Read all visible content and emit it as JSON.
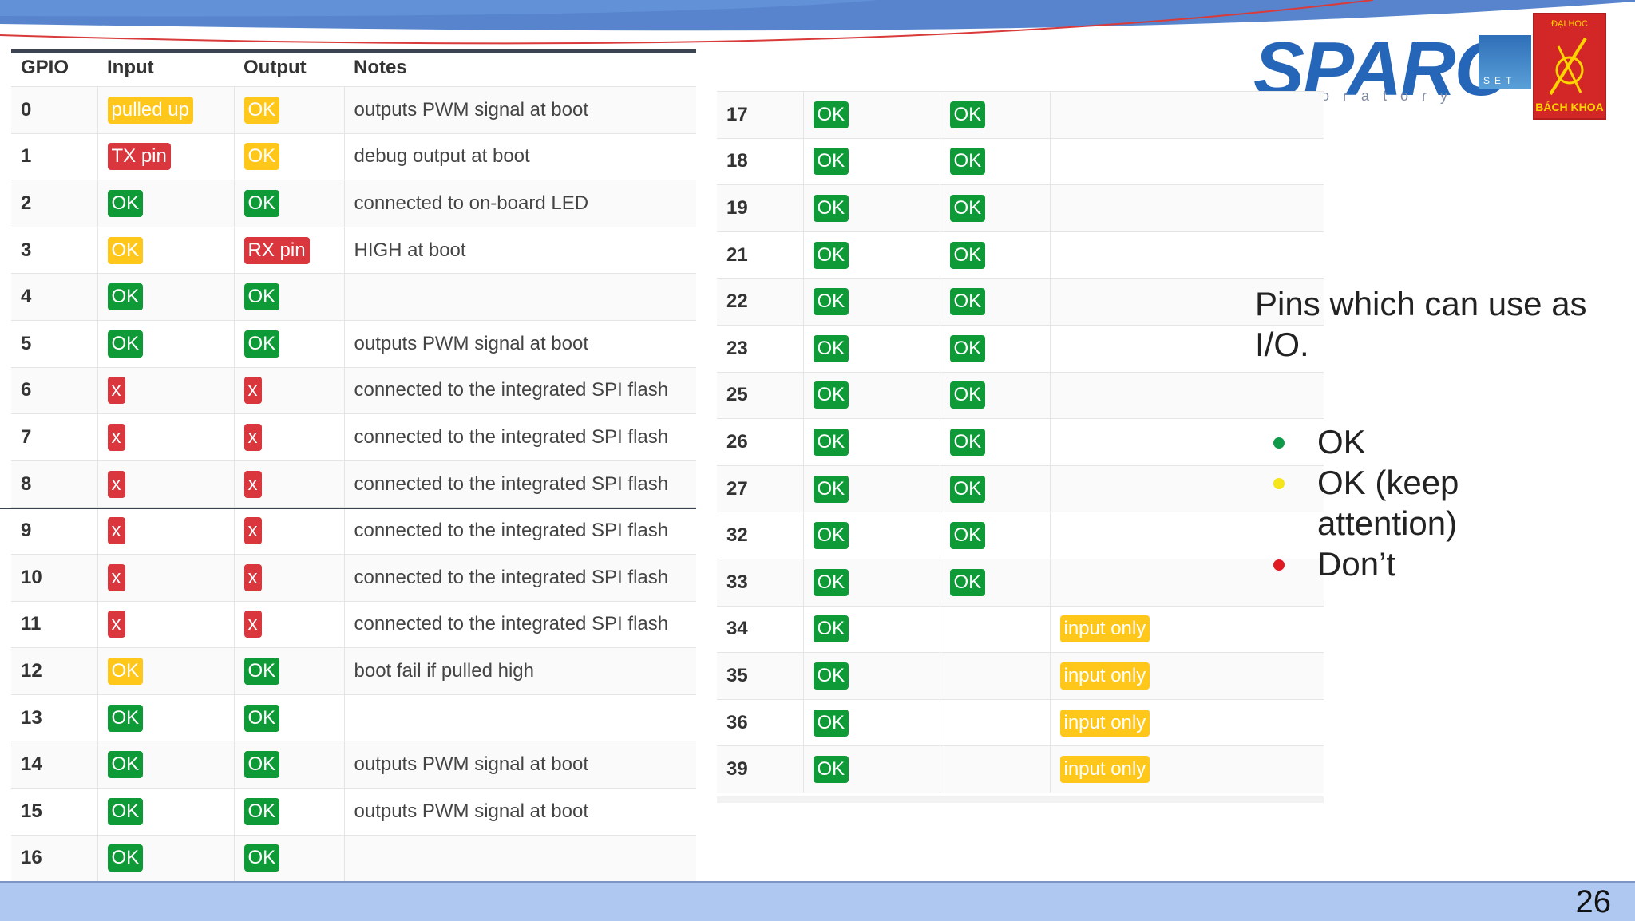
{
  "left_table": {
    "headers": [
      "GPIO",
      "Input",
      "Output",
      "Notes"
    ],
    "rows": [
      {
        "gpio": "0",
        "input": {
          "text": "pulled up",
          "status": "warn"
        },
        "output": {
          "text": "OK",
          "status": "warn"
        },
        "notes": "outputs PWM signal at boot"
      },
      {
        "gpio": "1",
        "input": {
          "text": "TX pin",
          "status": "bad"
        },
        "output": {
          "text": "OK",
          "status": "warn"
        },
        "notes": "debug output at boot"
      },
      {
        "gpio": "2",
        "input": {
          "text": "OK",
          "status": "ok"
        },
        "output": {
          "text": "OK",
          "status": "ok"
        },
        "notes": "connected to on-board LED"
      },
      {
        "gpio": "3",
        "input": {
          "text": "OK",
          "status": "warn"
        },
        "output": {
          "text": "RX pin",
          "status": "bad"
        },
        "notes": "HIGH at boot"
      },
      {
        "gpio": "4",
        "input": {
          "text": "OK",
          "status": "ok"
        },
        "output": {
          "text": "OK",
          "status": "ok"
        },
        "notes": ""
      },
      {
        "gpio": "5",
        "input": {
          "text": "OK",
          "status": "ok"
        },
        "output": {
          "text": "OK",
          "status": "ok"
        },
        "notes": "outputs PWM signal at boot"
      },
      {
        "gpio": "6",
        "input": {
          "text": "x",
          "status": "bad"
        },
        "output": {
          "text": "x",
          "status": "bad"
        },
        "notes": "connected to the integrated SPI flash"
      },
      {
        "gpio": "7",
        "input": {
          "text": "x",
          "status": "bad"
        },
        "output": {
          "text": "x",
          "status": "bad"
        },
        "notes": "connected to the integrated SPI flash"
      },
      {
        "gpio": "8",
        "input": {
          "text": "x",
          "status": "bad"
        },
        "output": {
          "text": "x",
          "status": "bad"
        },
        "notes": "connected to the integrated SPI flash"
      },
      {
        "gpio": "9",
        "input": {
          "text": "x",
          "status": "bad"
        },
        "output": {
          "text": "x",
          "status": "bad"
        },
        "notes": "connected to the integrated SPI flash"
      },
      {
        "gpio": "10",
        "input": {
          "text": "x",
          "status": "bad"
        },
        "output": {
          "text": "x",
          "status": "bad"
        },
        "notes": "connected to the integrated SPI flash"
      },
      {
        "gpio": "11",
        "input": {
          "text": "x",
          "status": "bad"
        },
        "output": {
          "text": "x",
          "status": "bad"
        },
        "notes": "connected to the integrated SPI flash"
      },
      {
        "gpio": "12",
        "input": {
          "text": "OK",
          "status": "warn"
        },
        "output": {
          "text": "OK",
          "status": "ok"
        },
        "notes": "boot fail if pulled high"
      },
      {
        "gpio": "13",
        "input": {
          "text": "OK",
          "status": "ok"
        },
        "output": {
          "text": "OK",
          "status": "ok"
        },
        "notes": ""
      },
      {
        "gpio": "14",
        "input": {
          "text": "OK",
          "status": "ok"
        },
        "output": {
          "text": "OK",
          "status": "ok"
        },
        "notes": "outputs PWM signal at boot"
      },
      {
        "gpio": "15",
        "input": {
          "text": "OK",
          "status": "ok"
        },
        "output": {
          "text": "OK",
          "status": "ok"
        },
        "notes": "outputs PWM signal at boot"
      },
      {
        "gpio": "16",
        "input": {
          "text": "OK",
          "status": "ok"
        },
        "output": {
          "text": "OK",
          "status": "ok"
        },
        "notes": ""
      }
    ]
  },
  "right_table": {
    "rows": [
      {
        "gpio": "17",
        "input": {
          "text": "OK",
          "status": "ok"
        },
        "output": {
          "text": "OK",
          "status": "ok"
        },
        "notes": null
      },
      {
        "gpio": "18",
        "input": {
          "text": "OK",
          "status": "ok"
        },
        "output": {
          "text": "OK",
          "status": "ok"
        },
        "notes": null
      },
      {
        "gpio": "19",
        "input": {
          "text": "OK",
          "status": "ok"
        },
        "output": {
          "text": "OK",
          "status": "ok"
        },
        "notes": null
      },
      {
        "gpio": "21",
        "input": {
          "text": "OK",
          "status": "ok"
        },
        "output": {
          "text": "OK",
          "status": "ok"
        },
        "notes": null
      },
      {
        "gpio": "22",
        "input": {
          "text": "OK",
          "status": "ok"
        },
        "output": {
          "text": "OK",
          "status": "ok"
        },
        "notes": null
      },
      {
        "gpio": "23",
        "input": {
          "text": "OK",
          "status": "ok"
        },
        "output": {
          "text": "OK",
          "status": "ok"
        },
        "notes": null
      },
      {
        "gpio": "25",
        "input": {
          "text": "OK",
          "status": "ok"
        },
        "output": {
          "text": "OK",
          "status": "ok"
        },
        "notes": null
      },
      {
        "gpio": "26",
        "input": {
          "text": "OK",
          "status": "ok"
        },
        "output": {
          "text": "OK",
          "status": "ok"
        },
        "notes": null
      },
      {
        "gpio": "27",
        "input": {
          "text": "OK",
          "status": "ok"
        },
        "output": {
          "text": "OK",
          "status": "ok"
        },
        "notes": null
      },
      {
        "gpio": "32",
        "input": {
          "text": "OK",
          "status": "ok"
        },
        "output": {
          "text": "OK",
          "status": "ok"
        },
        "notes": null
      },
      {
        "gpio": "33",
        "input": {
          "text": "OK",
          "status": "ok"
        },
        "output": {
          "text": "OK",
          "status": "ok"
        },
        "notes": null
      },
      {
        "gpio": "34",
        "input": {
          "text": "OK",
          "status": "ok"
        },
        "output": null,
        "notes": {
          "text": "input only",
          "status": "warn"
        }
      },
      {
        "gpio": "35",
        "input": {
          "text": "OK",
          "status": "ok"
        },
        "output": null,
        "notes": {
          "text": "input only",
          "status": "warn"
        }
      },
      {
        "gpio": "36",
        "input": {
          "text": "OK",
          "status": "ok"
        },
        "output": null,
        "notes": {
          "text": "input only",
          "status": "warn"
        }
      },
      {
        "gpio": "39",
        "input": {
          "text": "OK",
          "status": "ok"
        },
        "output": null,
        "notes": {
          "text": "input only",
          "status": "warn"
        }
      }
    ]
  },
  "side_text": "Pins which can use as I/O.",
  "legend": [
    {
      "label": "OK",
      "color": "#0f9a4a"
    },
    {
      "label": "OK (keep attention)",
      "color": "#f5e51a"
    },
    {
      "label": "Don’t",
      "color": "#e01b24"
    }
  ],
  "logos": {
    "sparc": "SPARC",
    "sparc_sub": "oratory",
    "set": "SET",
    "bk_top": "ĐẠI HỌC",
    "bk": "BÁCH KHOA"
  },
  "page_number": "26",
  "colors": {
    "ok": "#0f9a38",
    "warn": "#ffc71a",
    "bad": "#d9363e",
    "footer": "#aec8f2"
  }
}
